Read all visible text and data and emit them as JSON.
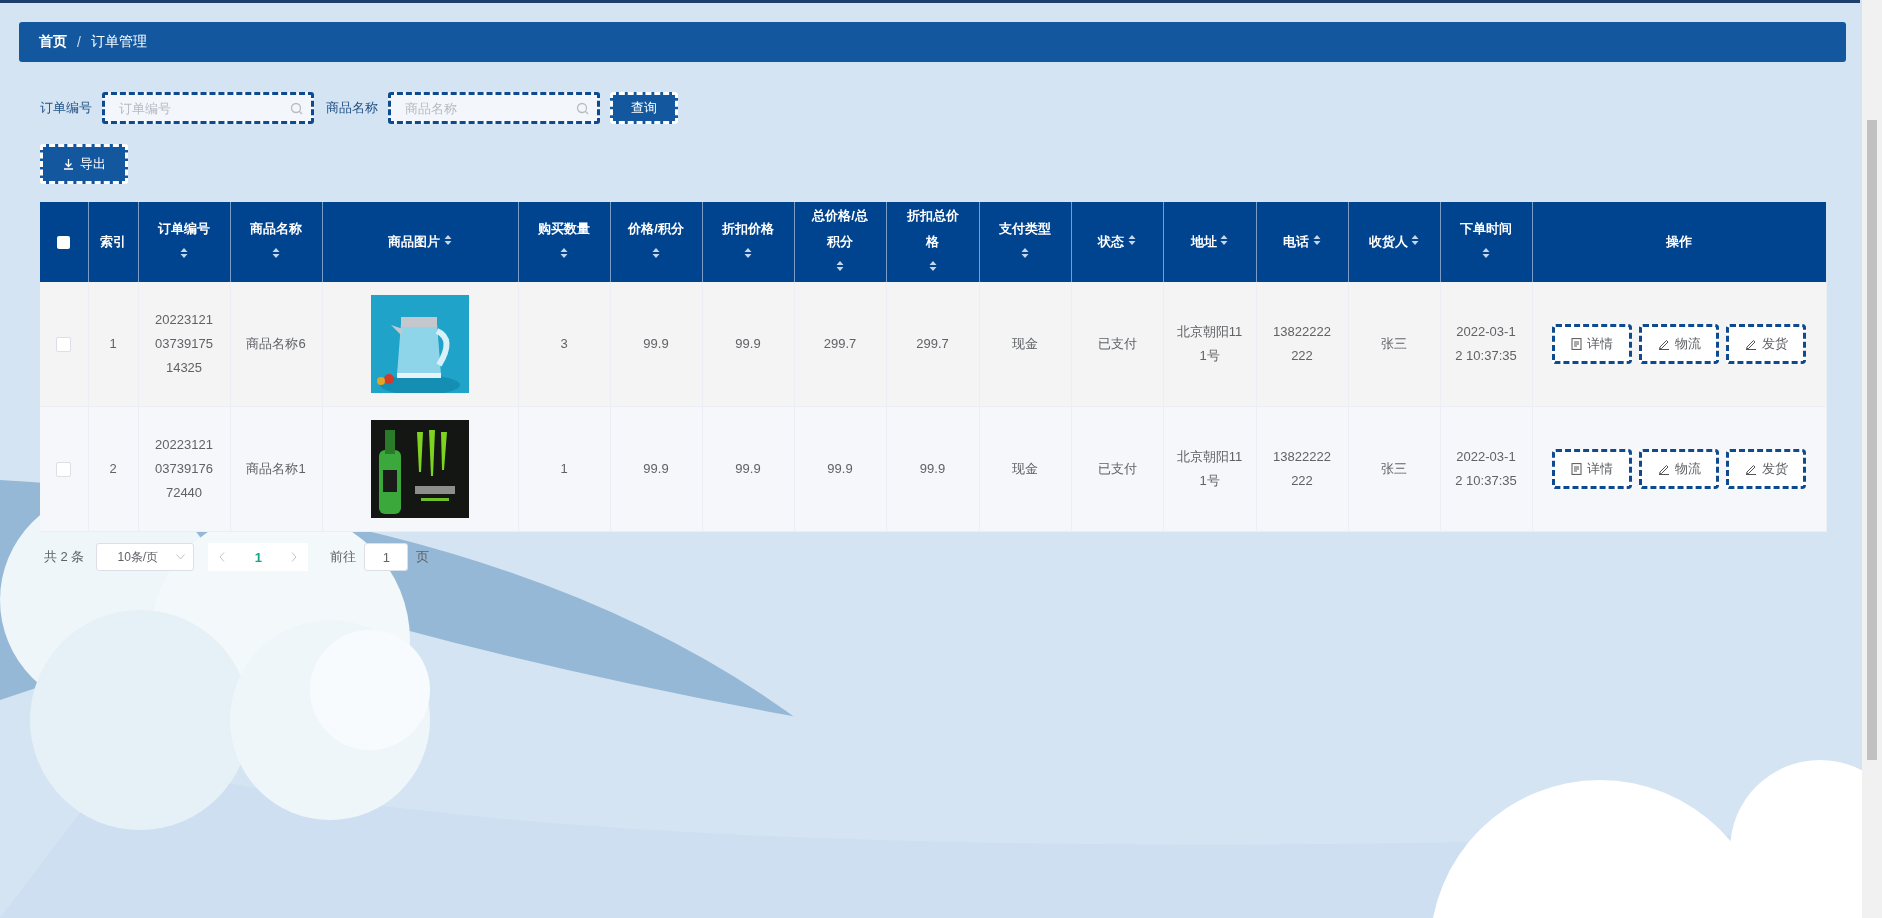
{
  "breadcrumb": [
    {
      "label": "首页",
      "current": false
    },
    {
      "label": "订单管理",
      "current": true
    }
  ],
  "breadcrumb_separator": "/",
  "search": {
    "fields": [
      {
        "label": "订单编号",
        "placeholder": "订单编号"
      },
      {
        "label": "商品名称",
        "placeholder": "商品名称"
      }
    ],
    "button": "查询"
  },
  "export_button": "导出",
  "table": {
    "select_all": {
      "checked": false
    },
    "columns": [
      {
        "label": "索引",
        "sortable": false
      },
      {
        "label": "订单编号",
        "sortable": true
      },
      {
        "label": "商品名称",
        "sortable": true
      },
      {
        "label": "商品图片",
        "sortable": true
      },
      {
        "label": "购买数量",
        "sortable": true
      },
      {
        "label": "价格/积分",
        "sortable": true
      },
      {
        "label": "折扣价格",
        "sortable": true
      },
      {
        "label": "总价格/总积分",
        "sortable": true
      },
      {
        "label": "折扣总价格",
        "sortable": true
      },
      {
        "label": "支付类型",
        "sortable": true
      },
      {
        "label": "状态",
        "sortable": true
      },
      {
        "label": "地址",
        "sortable": true
      },
      {
        "label": "电话",
        "sortable": true
      },
      {
        "label": "收货人",
        "sortable": true
      },
      {
        "label": "下单时间",
        "sortable": true
      },
      {
        "label": "操作",
        "sortable": false
      }
    ],
    "rows": [
      {
        "checked": false,
        "cells": [
          "1",
          "202231210373917514325",
          "商品名称6",
          {
            "kind": "picture"
          },
          "3",
          "99.9",
          "99.9",
          "299.7",
          "299.7",
          "现金",
          "已支付",
          "北京朝阳111号",
          "13822222222",
          "张三",
          "2022-03-12 10:37:35"
        ],
        "actions": [
          {
            "label": "详情"
          },
          {
            "label": "物流"
          },
          {
            "label": "发货"
          }
        ]
      },
      {
        "checked": false,
        "cells": [
          "2",
          "202231210373917672440",
          "商品名称1",
          {
            "kind": "picture"
          },
          "1",
          "99.9",
          "99.9",
          "99.9",
          "99.9",
          "现金",
          "已支付",
          "北京朝阳111号",
          "13822222222",
          "张三",
          "2022-03-12 10:37:35"
        ],
        "actions": [
          {
            "label": "详情"
          },
          {
            "label": "物流"
          },
          {
            "label": "发货"
          }
        ]
      }
    ]
  },
  "pagination": {
    "total": "共 2 条",
    "page_size": "10条/页",
    "pages": [
      {
        "label": "1",
        "selected": true
      }
    ],
    "goto_label": "前往",
    "goto_value": "1",
    "goto_suffix": "页"
  }
}
